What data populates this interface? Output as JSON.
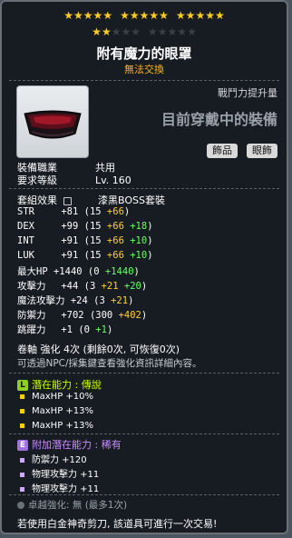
{
  "stars": {
    "row1_filled": 15,
    "row1_total": 15,
    "row2_filled": 2,
    "row2_total": 10
  },
  "title": "附有魔力的眼罩",
  "trade_note": "無法交換",
  "power": {
    "label": "戰鬥力提升量",
    "equipped": "目前穿戴中的裝備"
  },
  "tags": [
    "飾品",
    "眼飾"
  ],
  "job": {
    "label": "裝備職業",
    "value": "共用"
  },
  "level": {
    "label": "要求等級",
    "value": "Lv. 160"
  },
  "set": {
    "label": "套組效果",
    "value": "漆黑BOSS套裝"
  },
  "stats": [
    {
      "name": "STR",
      "total": "+81",
      "open": "(15",
      "a": "+66",
      "b": "",
      "close": ")"
    },
    {
      "name": "DEX",
      "total": "+99",
      "open": "(15",
      "a": "+66",
      "b": "+18",
      "close": ")"
    },
    {
      "name": "INT",
      "total": "+91",
      "open": "(15",
      "a": "+66",
      "b": "+10",
      "close": ")"
    },
    {
      "name": "LUK",
      "total": "+91",
      "open": "(15",
      "a": "+66",
      "b": "+10",
      "close": ")"
    },
    {
      "name": "最大HP",
      "total": "+1440",
      "open": "(0",
      "a": "",
      "b": "+1440",
      "close": ")"
    },
    {
      "name": "攻擊力",
      "total": "+44",
      "open": "(3",
      "a": "+21",
      "b": "+20",
      "close": ")"
    },
    {
      "name": "魔法攻擊力",
      "total": "+24",
      "open": "(3",
      "a": "+21",
      "b": "",
      "close": ")"
    },
    {
      "name": "防禦力",
      "total": "+702",
      "open": "(300",
      "a": "+402",
      "b": "",
      "close": ")"
    },
    {
      "name": "跳躍力",
      "total": "+1",
      "open": "(0",
      "a": "",
      "b": "+1",
      "close": ")"
    }
  ],
  "scroll_line": "卷軸 強化 4次 (剩餘0次, 可恢復0次)",
  "npc_note": "可透過NPC/採集鍵查看強化資訊詳細內容。",
  "potential": {
    "badge": "L",
    "label": "潛在能力 : ",
    "grade": "傳說",
    "lines": [
      "MaxHP +10%",
      "MaxHP +13%",
      "MaxHP +13%"
    ]
  },
  "additional": {
    "badge": "E",
    "label": "附加潛在能力 : ",
    "grade": "稀有",
    "lines": [
      "防禦力 +120",
      "物理攻擊力 +11",
      "物理攻擊力 +11"
    ]
  },
  "exceptional": "卓越強化: 無 (最多1次)",
  "footer": "若使用白金神奇剪刀, 該道具可進行一次交易!"
}
